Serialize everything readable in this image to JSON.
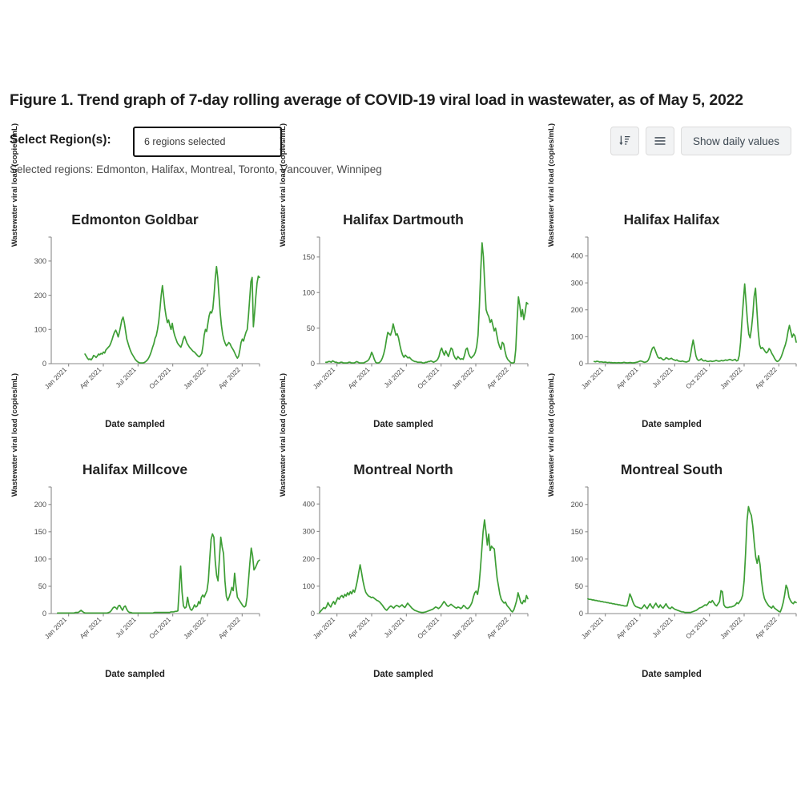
{
  "figure": {
    "title": "Figure 1. Trend graph of 7-day rolling average of COVID-19 viral load in wastewater, as of May 5, 2022"
  },
  "controls": {
    "select_label": "Select Region(s):",
    "region_value": "6 regions selected",
    "region_placeholder": "6 regions selected",
    "sort_button_icon": "sort-amount-down-icon",
    "list_button_icon": "list-lines-icon",
    "daily_values_label": "Show daily values"
  },
  "selected": {
    "prefix": "Selected regions:",
    "regions": [
      "Edmonton",
      "Halifax",
      "Montreal",
      "Toronto",
      "Vancouver",
      "Winnipeg"
    ],
    "text": "Selected regions: Edmonton, Halifax, Montreal, Toronto, Vancouver, Winnipeg"
  },
  "theme": {
    "line_color": "#3d9e35",
    "axis_color": "#8a8a8a",
    "text_color": "#232323",
    "button_bg": "#f2f3f4"
  },
  "common": {
    "ylabel": "Wastewater viral load (copies/mL)",
    "xlabel": "Date sampled",
    "xticklabels": [
      "Jan 2021",
      "Apr 2021",
      "Jul 2021",
      "Oct 2021",
      "Jan 2022",
      "Apr 2022"
    ],
    "xlim": [
      "2020-11-15",
      "2022-05-05"
    ]
  },
  "chart_data": [
    {
      "type": "line",
      "title": "Edmonton Goldbar",
      "xlabel": "Date sampled",
      "ylabel": "Wastewater viral load (copies/mL)",
      "yticks": [
        0,
        100,
        200,
        300
      ],
      "ylim": [
        0,
        370
      ],
      "xticklabels": [
        "Jan 2021",
        "Apr 2021",
        "Jul 2021",
        "Oct 2021",
        "Jan 2022",
        "Apr 2022"
      ],
      "grid": false,
      "legend": false,
      "series": [
        {
          "name": "7-day rolling average viral load",
          "color": "#3d9e35",
          "x_start_frac": 0.162,
          "values": [
            28,
            22,
            16,
            12,
            14,
            11,
            16,
            24,
            22,
            18,
            22,
            28,
            26,
            30,
            28,
            34,
            31,
            40,
            44,
            48,
            52,
            60,
            70,
            82,
            92,
            98,
            90,
            78,
            92,
            110,
            128,
            136,
            120,
            96,
            72,
            60,
            48,
            38,
            30,
            24,
            18,
            12,
            8,
            5,
            3,
            2,
            2,
            2,
            3,
            5,
            8,
            12,
            18,
            26,
            36,
            48,
            58,
            74,
            82,
            100,
            124,
            160,
            200,
            228,
            196,
            162,
            138,
            120,
            128,
            112,
            100,
            118,
            96,
            82,
            72,
            62,
            56,
            52,
            48,
            58,
            72,
            80,
            70,
            60,
            54,
            48,
            44,
            40,
            36,
            34,
            30,
            26,
            22,
            20,
            24,
            30,
            52,
            84,
            100,
            94,
            118,
            140,
            152,
            148,
            160,
            200,
            250,
            284,
            252,
            200,
            150,
            112,
            86,
            70,
            60,
            52,
            56,
            62,
            58,
            50,
            44,
            38,
            30,
            22,
            16,
            22,
            40,
            62,
            72,
            66,
            80,
            92,
            100,
            140,
            190,
            240,
            252,
            108,
            148,
            196,
            236,
            256,
            252
          ]
        }
      ]
    },
    {
      "type": "line",
      "title": "Halifax Dartmouth",
      "xlabel": "Date sampled",
      "ylabel": "Wastewater viral load (copies/mL)",
      "yticks": [
        0,
        50,
        100,
        150
      ],
      "ylim": [
        0,
        178
      ],
      "xticklabels": [
        "Jan 2021",
        "Apr 2021",
        "Jul 2021",
        "Oct 2021",
        "Jan 2022",
        "Apr 2022"
      ],
      "grid": false,
      "legend": false,
      "series": [
        {
          "name": "7-day rolling average viral load",
          "color": "#3d9e35",
          "x_start_frac": 0.03,
          "values": [
            2,
            2,
            3,
            3,
            2,
            4,
            3,
            2,
            2,
            1,
            1,
            2,
            2,
            1,
            1,
            1,
            1,
            2,
            2,
            1,
            1,
            1,
            2,
            3,
            2,
            1,
            1,
            1,
            1,
            2,
            3,
            4,
            6,
            10,
            16,
            12,
            6,
            2,
            1,
            1,
            2,
            4,
            8,
            14,
            22,
            34,
            44,
            42,
            40,
            46,
            56,
            48,
            40,
            42,
            36,
            26,
            18,
            12,
            9,
            12,
            10,
            8,
            9,
            7,
            5,
            4,
            3,
            3,
            2,
            2,
            2,
            2,
            1,
            1,
            2,
            2,
            3,
            3,
            4,
            3,
            2,
            3,
            4,
            6,
            10,
            18,
            22,
            16,
            12,
            18,
            14,
            10,
            16,
            22,
            20,
            12,
            8,
            6,
            10,
            8,
            6,
            7,
            6,
            12,
            20,
            22,
            14,
            10,
            8,
            10,
            12,
            16,
            24,
            40,
            80,
            130,
            170,
            150,
            110,
            76,
            70,
            66,
            58,
            62,
            54,
            46,
            50,
            40,
            30,
            24,
            20,
            30,
            28,
            18,
            10,
            6,
            4,
            2,
            1,
            1,
            2,
            20,
            60,
            94,
            82,
            66,
            76,
            62,
            72,
            86,
            84
          ]
        }
      ]
    },
    {
      "type": "line",
      "title": "Halifax Halifax",
      "xlabel": "Date sampled",
      "ylabel": "Wastewater viral load (copies/mL)",
      "yticks": [
        0,
        100,
        200,
        300,
        400
      ],
      "ylim": [
        0,
        470
      ],
      "xticklabels": [
        "Jan 2021",
        "Apr 2021",
        "Jul 2021",
        "Oct 2021",
        "Jan 2022",
        "Apr 2022"
      ],
      "grid": false,
      "legend": false,
      "series": [
        {
          "name": "7-day rolling average viral load",
          "color": "#3d9e35",
          "x_start_frac": 0.03,
          "values": [
            8,
            7,
            9,
            8,
            6,
            7,
            6,
            5,
            6,
            5,
            4,
            5,
            4,
            4,
            3,
            4,
            3,
            3,
            4,
            3,
            3,
            4,
            5,
            4,
            3,
            3,
            4,
            4,
            3,
            3,
            4,
            5,
            6,
            8,
            10,
            9,
            7,
            5,
            6,
            8,
            14,
            26,
            44,
            58,
            62,
            50,
            36,
            24,
            20,
            22,
            18,
            14,
            16,
            22,
            20,
            16,
            18,
            20,
            16,
            14,
            12,
            14,
            10,
            9,
            8,
            10,
            8,
            7,
            6,
            8,
            10,
            30,
            62,
            88,
            60,
            30,
            16,
            12,
            14,
            18,
            12,
            10,
            12,
            9,
            8,
            9,
            10,
            8,
            9,
            10,
            12,
            10,
            9,
            10,
            12,
            10,
            12,
            14,
            12,
            14,
            16,
            14,
            12,
            14,
            16,
            10,
            12,
            30,
            80,
            160,
            230,
            296,
            230,
            160,
            110,
            96,
            130,
            180,
            250,
            280,
            200,
            120,
            70,
            56,
            60,
            54,
            46,
            40,
            44,
            56,
            50,
            38,
            30,
            20,
            12,
            8,
            10,
            16,
            26,
            40,
            56,
            70,
            90,
            120,
            142,
            120,
            98,
            110,
            104,
            80
          ]
        }
      ]
    },
    {
      "type": "line",
      "title": "Halifax Millcove",
      "xlabel": "Date sampled",
      "ylabel": "Wastewater viral load (copies/mL)",
      "yticks": [
        0,
        50,
        100,
        150,
        200
      ],
      "ylim": [
        0,
        232
      ],
      "xticklabels": [
        "Jan 2021",
        "Apr 2021",
        "Jul 2021",
        "Oct 2021",
        "Jan 2022",
        "Apr 2022"
      ],
      "grid": false,
      "legend": false,
      "series": [
        {
          "name": "7-day rolling average viral load",
          "color": "#3d9e35",
          "x_start_frac": 0.03,
          "values": [
            1,
            1,
            1,
            1,
            1,
            1,
            1,
            1,
            1,
            1,
            1,
            1,
            1,
            2,
            2,
            2,
            4,
            6,
            4,
            2,
            1,
            1,
            1,
            1,
            1,
            1,
            1,
            1,
            1,
            1,
            1,
            1,
            1,
            1,
            1,
            1,
            1,
            2,
            3,
            6,
            10,
            12,
            11,
            8,
            14,
            15,
            10,
            6,
            12,
            14,
            8,
            4,
            2,
            2,
            1,
            1,
            1,
            1,
            1,
            1,
            1,
            1,
            1,
            1,
            1,
            1,
            1,
            1,
            1,
            1,
            2,
            2,
            2,
            2,
            2,
            2,
            2,
            2,
            2,
            2,
            2,
            2,
            3,
            3,
            3,
            4,
            4,
            5,
            46,
            87,
            40,
            14,
            10,
            12,
            30,
            16,
            8,
            6,
            10,
            16,
            12,
            14,
            22,
            18,
            30,
            34,
            30,
            36,
            42,
            60,
            100,
            136,
            146,
            140,
            96,
            70,
            60,
            100,
            140,
            122,
            110,
            60,
            32,
            24,
            30,
            38,
            48,
            42,
            74,
            50,
            30,
            26,
            22,
            18,
            14,
            12,
            14,
            30,
            60,
            92,
            120,
            106,
            80,
            84,
            90,
            96,
            98
          ]
        }
      ]
    },
    {
      "type": "line",
      "title": "Montreal North",
      "xlabel": "Date sampled",
      "ylabel": "Wastewater viral load (copies/mL)",
      "yticks": [
        0,
        100,
        200,
        300,
        400
      ],
      "ylim": [
        0,
        462
      ],
      "xticklabels": [
        "Jan 2021",
        "Apr 2021",
        "Jul 2021",
        "Oct 2021",
        "Jan 2022",
        "Apr 2022"
      ],
      "grid": false,
      "legend": false,
      "series": [
        {
          "name": "7-day rolling average viral load",
          "color": "#3d9e35",
          "x_start_frac": 0.0,
          "values": [
            4,
            10,
            16,
            22,
            18,
            26,
            40,
            30,
            24,
            36,
            44,
            34,
            46,
            58,
            52,
            62,
            66,
            58,
            70,
            64,
            76,
            68,
            80,
            72,
            86,
            78,
            96,
            120,
            150,
            178,
            150,
            120,
            96,
            78,
            70,
            64,
            62,
            58,
            60,
            56,
            52,
            48,
            46,
            42,
            36,
            30,
            22,
            16,
            12,
            18,
            24,
            28,
            24,
            20,
            26,
            30,
            28,
            24,
            28,
            32,
            26,
            22,
            30,
            38,
            32,
            26,
            20,
            16,
            12,
            10,
            8,
            6,
            5,
            4,
            4,
            5,
            6,
            8,
            10,
            12,
            14,
            16,
            20,
            24,
            22,
            18,
            22,
            28,
            36,
            44,
            38,
            30,
            26,
            30,
            34,
            30,
            26,
            22,
            20,
            24,
            22,
            18,
            22,
            30,
            26,
            20,
            18,
            22,
            30,
            40,
            60,
            76,
            82,
            70,
            100,
            160,
            230,
            300,
            342,
            300,
            250,
            290,
            230,
            246,
            240,
            236,
            180,
            130,
            100,
            70,
            52,
            44,
            38,
            42,
            30,
            24,
            18,
            10,
            6,
            14,
            30,
            48,
            76,
            58,
            40,
            36,
            48,
            42,
            66,
            54
          ]
        }
      ]
    },
    {
      "type": "line",
      "title": "Montreal South",
      "xlabel": "Date sampled",
      "ylabel": "Wastewater viral load (copies/mL)",
      "yticks": [
        0,
        50,
        100,
        150,
        200
      ],
      "ylim": [
        0,
        232
      ],
      "xticklabels": [
        "Jan 2021",
        "Apr 2021",
        "Jul 2021",
        "Oct 2021",
        "Jan 2022",
        "Apr 2022"
      ],
      "grid": false,
      "legend": false,
      "series": [
        {
          "name": "7-day rolling average viral load",
          "color": "#3d9e35",
          "x_start_frac": 0.0,
          "values": [
            27,
            26,
            26,
            25,
            25,
            24,
            24,
            23,
            23,
            22,
            22,
            21,
            21,
            20,
            20,
            19,
            19,
            18,
            18,
            17,
            17,
            16,
            16,
            15,
            15,
            14,
            14,
            14,
            24,
            36,
            30,
            22,
            16,
            13,
            12,
            11,
            10,
            9,
            12,
            16,
            12,
            9,
            14,
            18,
            13,
            10,
            15,
            19,
            14,
            11,
            16,
            12,
            10,
            14,
            18,
            13,
            10,
            9,
            12,
            10,
            8,
            7,
            6,
            5,
            4,
            3,
            3,
            2,
            2,
            2,
            2,
            2,
            3,
            4,
            5,
            6,
            8,
            10,
            11,
            12,
            14,
            16,
            15,
            18,
            22,
            20,
            24,
            20,
            16,
            14,
            18,
            22,
            42,
            40,
            16,
            12,
            11,
            11,
            12,
            12,
            13,
            14,
            16,
            20,
            18,
            22,
            26,
            34,
            60,
            110,
            170,
            196,
            186,
            180,
            160,
            130,
            104,
            92,
            106,
            90,
            60,
            40,
            28,
            22,
            18,
            14,
            12,
            10,
            14,
            10,
            8,
            6,
            4,
            3,
            10,
            20,
            34,
            52,
            46,
            30,
            24,
            20,
            18,
            22,
            20
          ]
        }
      ]
    }
  ]
}
